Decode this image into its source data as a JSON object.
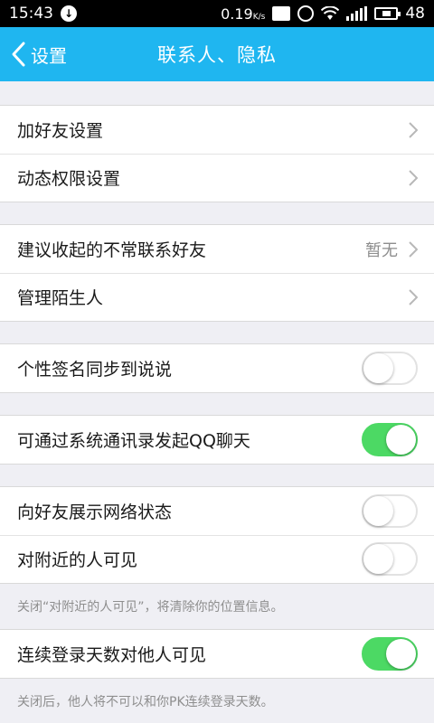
{
  "status_bar": {
    "time": "15:43",
    "speed_value": "0.19",
    "speed_unit": "K/s",
    "battery": "48"
  },
  "nav": {
    "back_label": "设置",
    "title": "联系人、隐私"
  },
  "groups": {
    "g1": {
      "add_friend": "加好友设置",
      "feed_permission": "动态权限设置"
    },
    "g2": {
      "fold_contacts": "建议收起的不常联系好友",
      "fold_contacts_value": "暂无",
      "strangers": "管理陌生人"
    },
    "g3": {
      "signature_sync": "个性签名同步到说说",
      "signature_sync_on": false
    },
    "g4": {
      "address_book_chat": "可通过系统通讯录发起QQ聊天",
      "address_book_chat_on": true
    },
    "g5": {
      "network_status": "向好友展示网络状态",
      "network_status_on": false,
      "nearby_visible": "对附近的人可见",
      "nearby_visible_on": false,
      "nearby_note": "关闭“对附近的人可见”，将清除你的位置信息。"
    },
    "g6": {
      "login_days": "连续登录天数对他人可见",
      "login_days_on": true,
      "login_days_note": "关闭后，他人将不可以和你PK连续登录天数。"
    }
  },
  "colors": {
    "nav_bg": "#1fb6f0",
    "toggle_on": "#4cd964",
    "page_bg": "#efeff4"
  }
}
